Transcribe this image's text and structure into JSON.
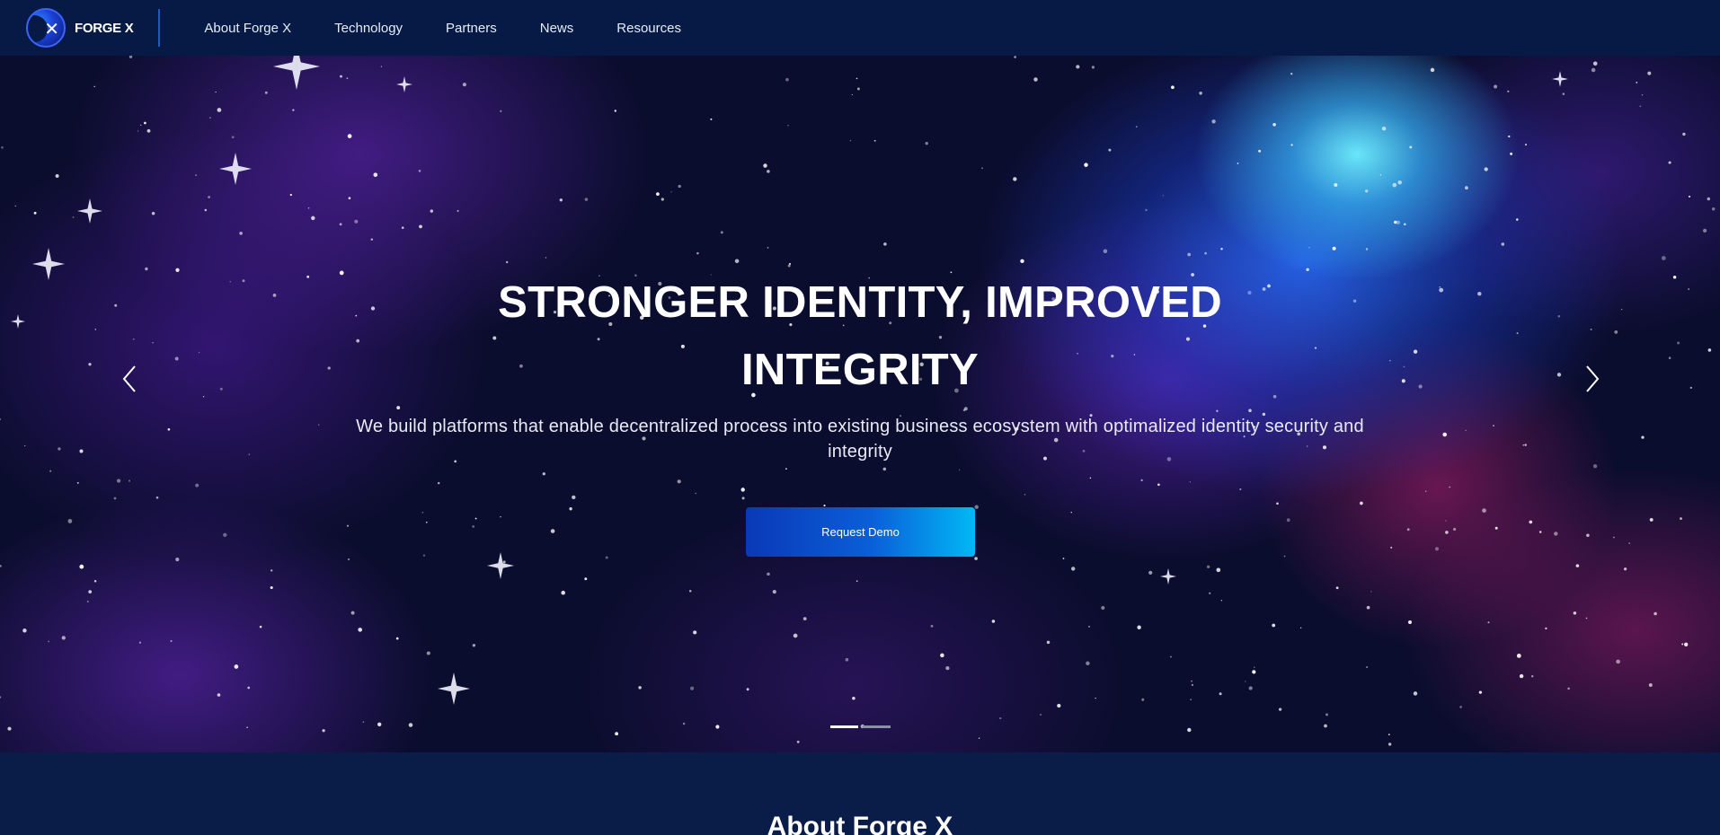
{
  "header": {
    "logo_text": "FORGE X",
    "logo_icon": "forge-x-logo-icon",
    "nav": [
      {
        "label": "About Forge X"
      },
      {
        "label": "Technology"
      },
      {
        "label": "Partners"
      },
      {
        "label": "News"
      },
      {
        "label": "Resources"
      }
    ]
  },
  "hero": {
    "title": "STRONGER IDENTITY, IMPROVED INTEGRITY",
    "subtitle": "We build platforms that enable decentralized process into existing business ecosystem with optimalized identity security and integrity",
    "cta_label": "Request Demo",
    "prev_icon": "chevron-left-icon",
    "next_icon": "chevron-right-icon",
    "slides": 2,
    "active_slide": 1
  },
  "about": {
    "title": "About Forge X"
  },
  "colors": {
    "header_bg": "#061a45",
    "cta_start": "#0a39b7",
    "cta_end": "#02b8f5",
    "section_bg": "#0a1c48"
  }
}
